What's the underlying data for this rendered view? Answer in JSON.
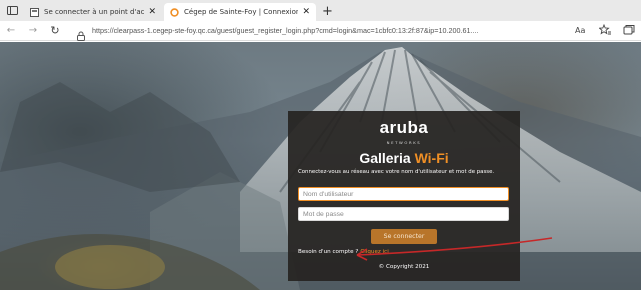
{
  "browser": {
    "tabs": [
      {
        "title": "Se connecter à un point d'accès",
        "active": false
      },
      {
        "title": "Cégep de Sainte-Foy | Connexion",
        "active": true
      }
    ],
    "new_tab_label": "+",
    "tab_close_label": "✕",
    "address": {
      "url": "https://clearpass-1.cegep-ste-foy.qc.ca/guest/guest_register_login.php?cmd=login&mac=1cbfc0:13:2f:87&ip=10.200.61...."
    }
  },
  "login": {
    "brand": "aruba",
    "brand_sub": "NETWORKS",
    "heading_main": "Galleria",
    "heading_accent": "Wi-Fi",
    "intro": "Connectez-vous au réseau avec votre nom d'utilisateur et mot de passe.",
    "username_placeholder": "Nom d'utilisateur",
    "password_placeholder": "Mot de passe",
    "submit_label": "Se connecter",
    "account_prompt": "Besoin d'un compte ?",
    "account_link": "Cliquez ici",
    "copyright": "© Copyright 2021"
  },
  "colors": {
    "accent": "#f08f25",
    "annotation_arrow": "#c62828"
  }
}
